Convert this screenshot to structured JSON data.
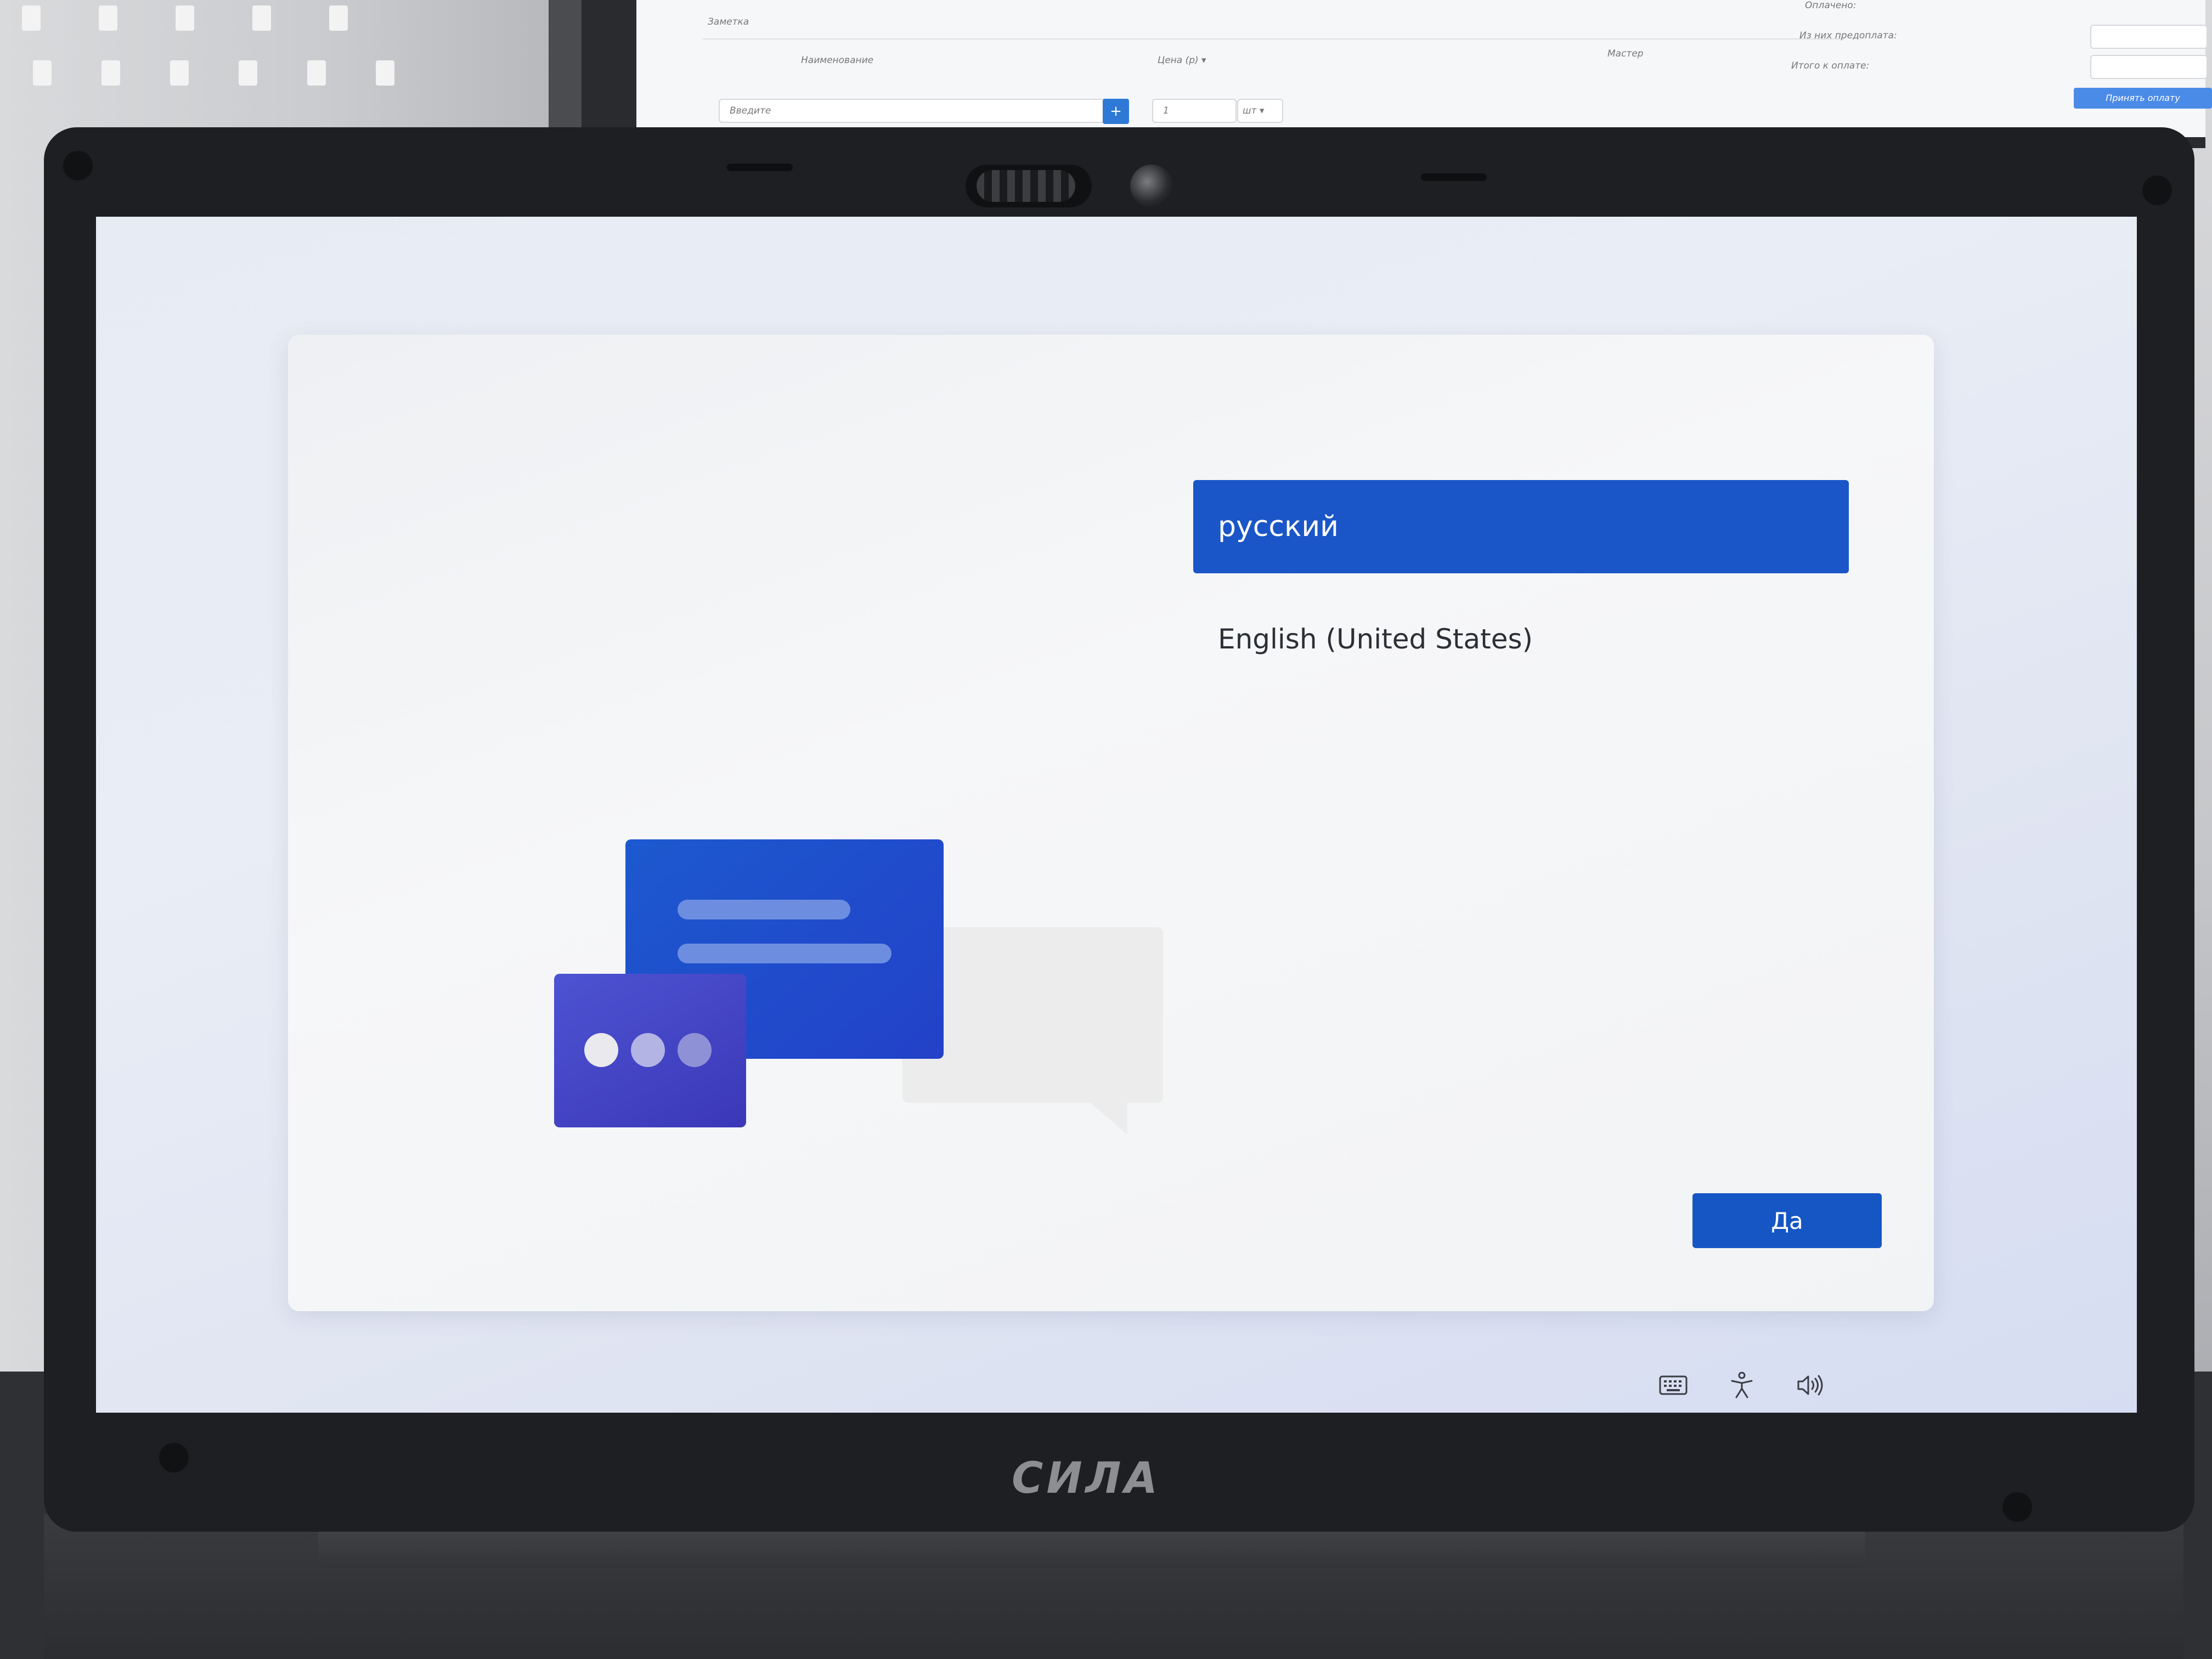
{
  "oobe": {
    "languages": [
      {
        "label": "русский",
        "selected": true
      },
      {
        "label": "English (United States)",
        "selected": false
      }
    ],
    "confirm_button": "Да"
  },
  "tray": {
    "icons": [
      "keyboard-icon",
      "accessibility-icon",
      "volume-icon"
    ]
  },
  "device": {
    "brand": "СИЛА"
  },
  "background_monitor": {
    "texts": [
      "Заметка",
      "Наименование",
      "Цена (р) ▾",
      "Мастер",
      "Оплачено:",
      "Из них предоплата:",
      "Итого к оплате:",
      "Принять оплату",
      "Введите",
      "1",
      "шт ▾"
    ]
  },
  "colors": {
    "accent": "#1a56c7",
    "button": "#1656c4",
    "text": "#2c2f36"
  }
}
